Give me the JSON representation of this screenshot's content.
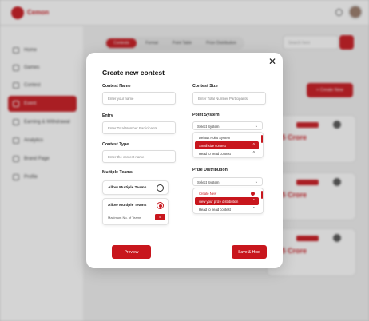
{
  "app": {
    "brand": "Cemon",
    "sidebar": {
      "items": [
        {
          "label": "Home",
          "icon": "home-icon"
        },
        {
          "label": "Games",
          "icon": "games-icon"
        },
        {
          "label": "Contest",
          "icon": "trophy-icon"
        },
        {
          "label": "Event",
          "icon": "calendar-icon",
          "active": true
        },
        {
          "label": "Earning & Withdrawal",
          "icon": "wallet-icon"
        },
        {
          "label": "Analytics",
          "icon": "chart-icon"
        },
        {
          "label": "Brand Page",
          "icon": "page-icon"
        },
        {
          "label": "Profile",
          "icon": "user-icon"
        }
      ]
    },
    "tabs": [
      "Contests",
      "Format",
      "Point Table",
      "Prize Distribution"
    ],
    "search_placeholder": "Search here",
    "create_button": "+ Create New",
    "card": {
      "badge": "Mega Contest",
      "amount": "1.5 Crore"
    }
  },
  "modal": {
    "title": "Create new contest",
    "contest_name": {
      "label": "Contest Name",
      "placeholder": "Enter your name"
    },
    "contest_size": {
      "label": "Contest Size",
      "placeholder": "Enter Total Number Participants"
    },
    "entry": {
      "label": "Entry",
      "placeholder": "Enter Total Number Participants"
    },
    "point_system": {
      "label": "Point System",
      "select": "Select System",
      "options": [
        "Default Point System",
        "Small size contest",
        "Head to head contest"
      ]
    },
    "contest_type": {
      "label": "Contest Type",
      "placeholder": "Enter the contest name"
    },
    "multiple_teams": {
      "label": "Multiple Teams",
      "allow_label": "Allow Multiple Teams",
      "allow_label_2": "Allow Multiple Teams",
      "max_label": "Maximum No. of Teams",
      "max_value": "5"
    },
    "prize_distribution": {
      "label": "Prize Distribution",
      "select": "Select System",
      "options": [
        "Create New",
        "view your prize distribution",
        "Head to head contest"
      ]
    },
    "preview_button": "Preview",
    "save_button": "Save & Host"
  }
}
